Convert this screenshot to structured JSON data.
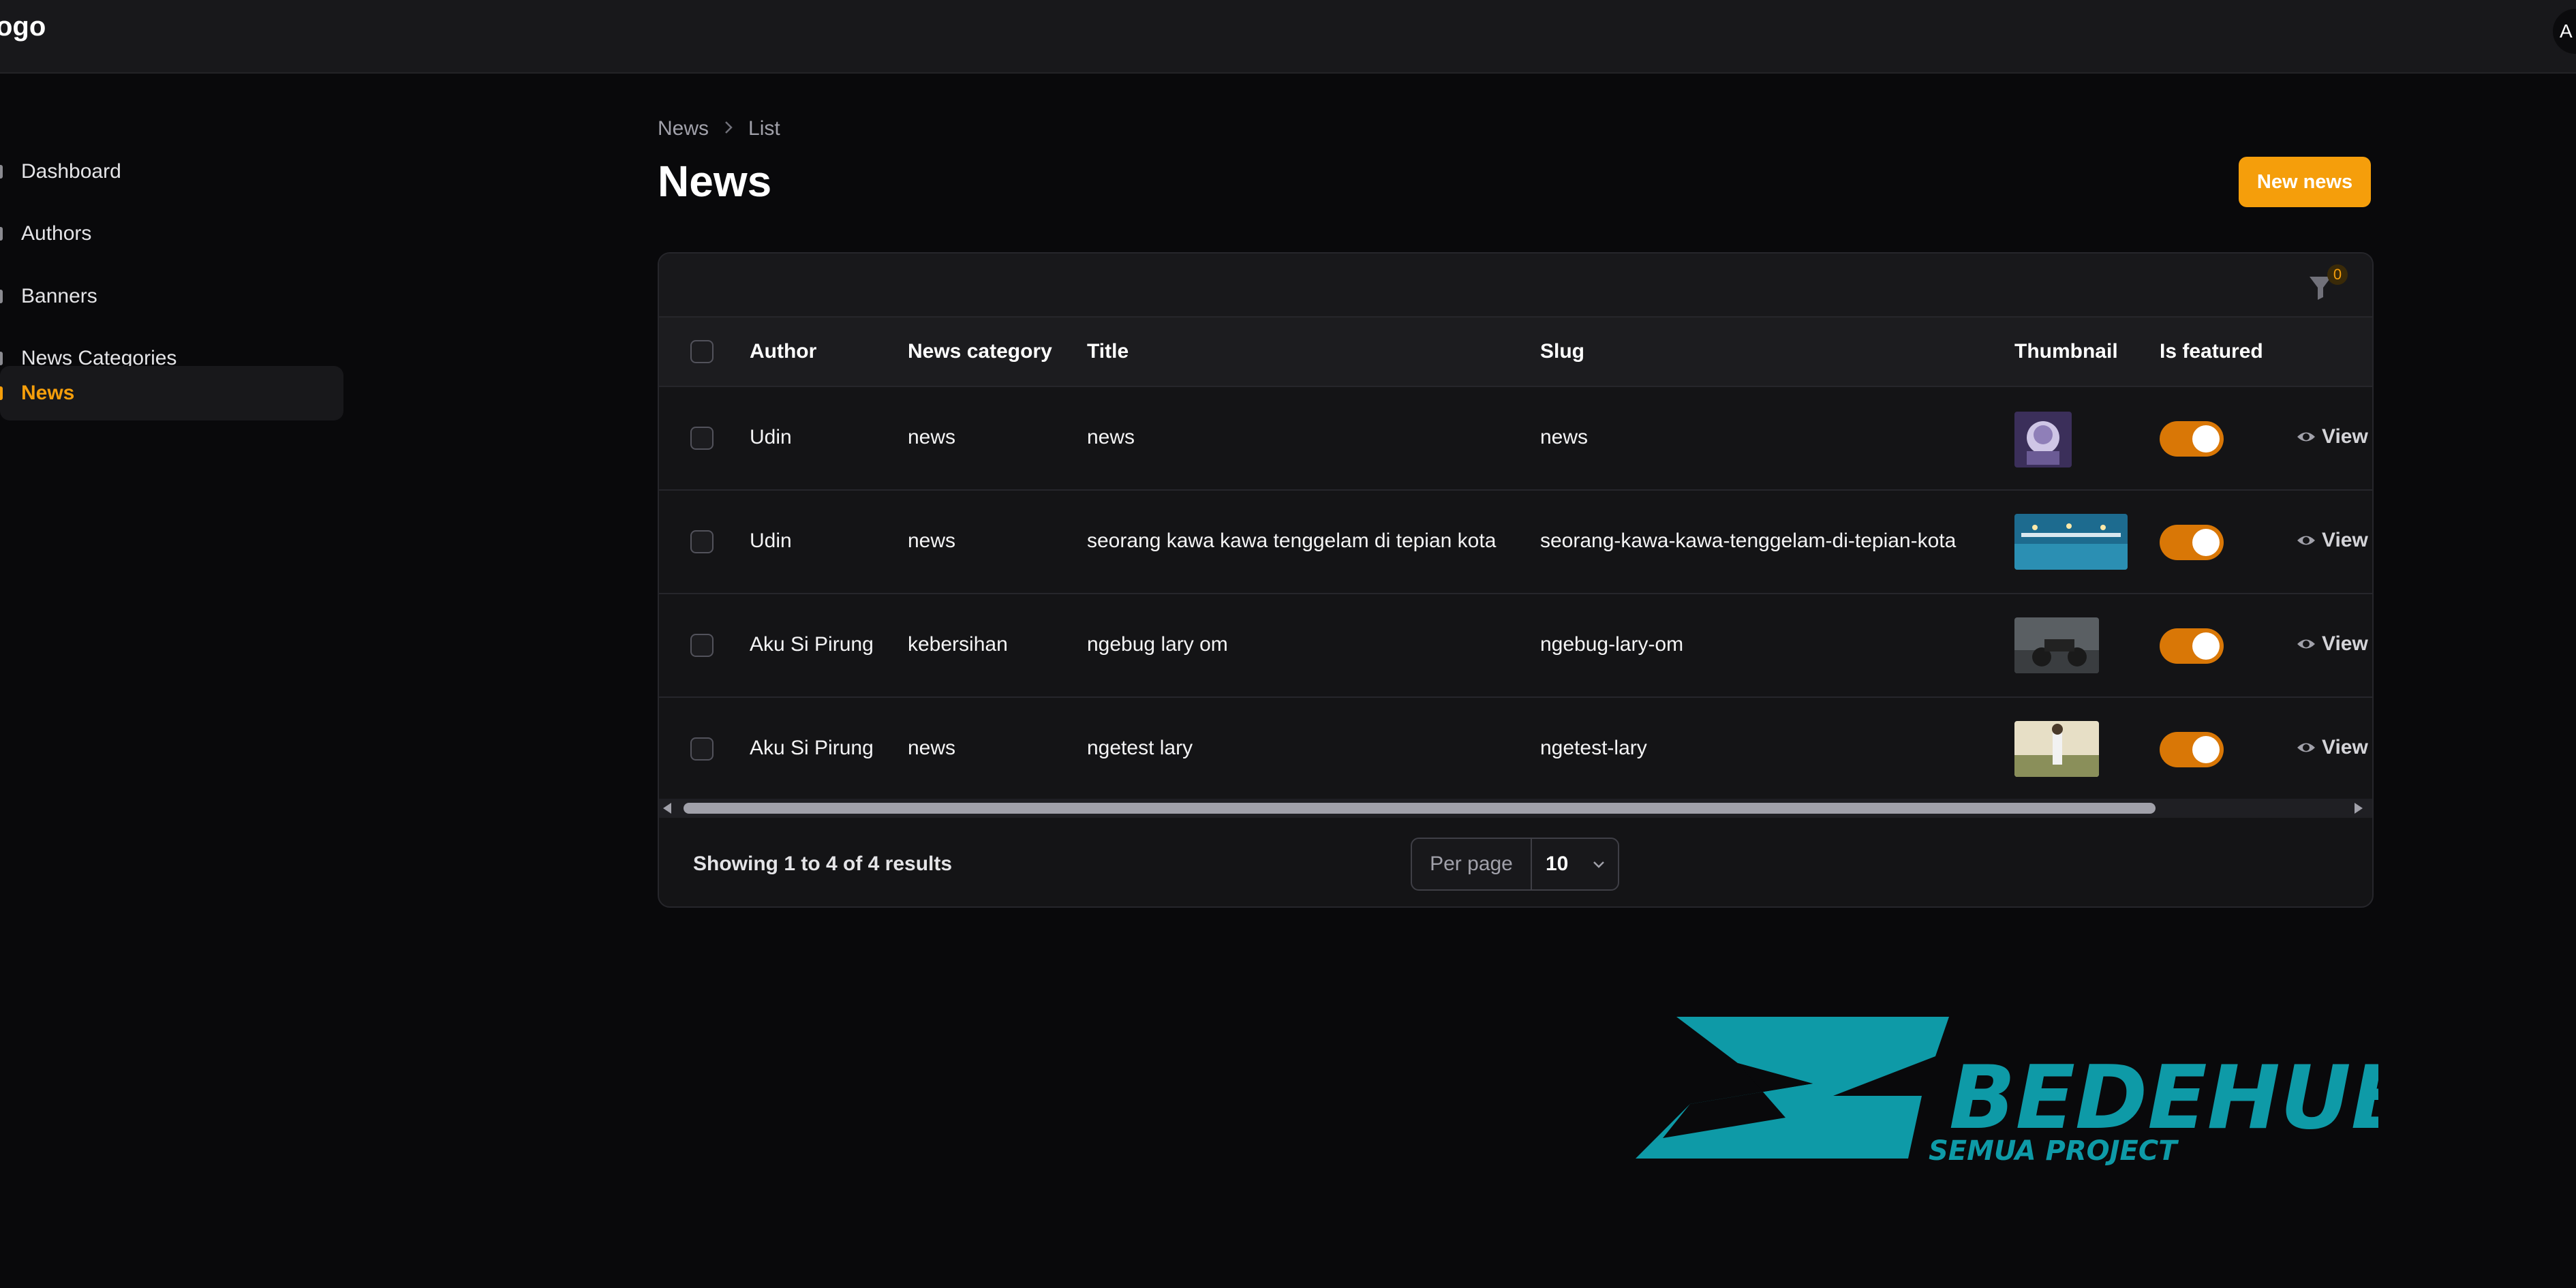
{
  "app": {
    "logo_text": "ogo",
    "avatar_text": "A"
  },
  "sidebar": {
    "items": [
      {
        "label": "Dashboard",
        "active": false
      },
      {
        "label": "Authors",
        "active": false
      },
      {
        "label": "Banners",
        "active": false
      },
      {
        "label": "News Categories",
        "active": false
      },
      {
        "label": "News",
        "active": true
      }
    ]
  },
  "breadcrumb": {
    "items": [
      "News",
      "List"
    ]
  },
  "header": {
    "title": "News",
    "new_button": "New news"
  },
  "table": {
    "filter_count": "0",
    "columns": [
      "Author",
      "News category",
      "Title",
      "Slug",
      "Thumbnail",
      "Is featured"
    ],
    "rows": [
      {
        "author": "Udin",
        "category": "news",
        "title": "news",
        "slug": "news",
        "featured": true,
        "action": "View"
      },
      {
        "author": "Udin",
        "category": "news",
        "title": "seorang kawa kawa tenggelam di tepian kota",
        "slug": "seorang-kawa-kawa-tenggelam-di-tepian-kota",
        "featured": true,
        "action": "View"
      },
      {
        "author": "Aku Si Pirung",
        "category": "kebersihan",
        "title": "ngebug lary om",
        "slug": "ngebug-lary-om",
        "featured": true,
        "action": "View"
      },
      {
        "author": "Aku Si Pirung",
        "category": "news",
        "title": "ngetest lary",
        "slug": "ngetest-lary",
        "featured": true,
        "action": "View"
      }
    ],
    "footer": {
      "showing_text": "Showing 1 to 4 of 4 results",
      "per_page_label": "Per page",
      "per_page_value": "10"
    }
  },
  "watermark": {
    "brand": "BEDEHUB",
    "tagline": "SEMUA PROJECT"
  },
  "colors": {
    "accent": "#f59e0b",
    "toggle_on": "#d97706",
    "brand_teal": "#0e9aa7",
    "background": "#09090b"
  }
}
